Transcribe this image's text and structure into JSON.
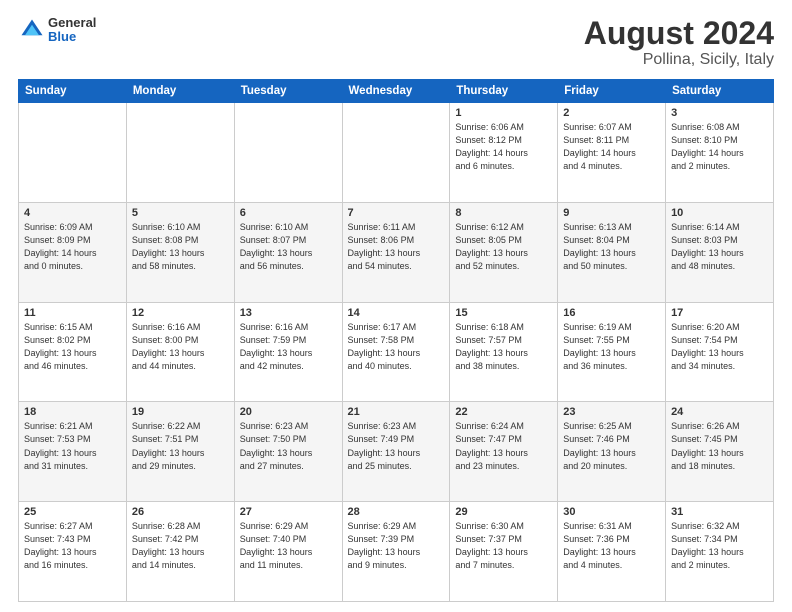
{
  "header": {
    "logo_general": "General",
    "logo_blue": "Blue",
    "month_title": "August 2024",
    "location": "Pollina, Sicily, Italy"
  },
  "weekdays": [
    "Sunday",
    "Monday",
    "Tuesday",
    "Wednesday",
    "Thursday",
    "Friday",
    "Saturday"
  ],
  "rows": [
    [
      {
        "day": "",
        "info": ""
      },
      {
        "day": "",
        "info": ""
      },
      {
        "day": "",
        "info": ""
      },
      {
        "day": "",
        "info": ""
      },
      {
        "day": "1",
        "info": "Sunrise: 6:06 AM\nSunset: 8:12 PM\nDaylight: 14 hours\nand 6 minutes."
      },
      {
        "day": "2",
        "info": "Sunrise: 6:07 AM\nSunset: 8:11 PM\nDaylight: 14 hours\nand 4 minutes."
      },
      {
        "day": "3",
        "info": "Sunrise: 6:08 AM\nSunset: 8:10 PM\nDaylight: 14 hours\nand 2 minutes."
      }
    ],
    [
      {
        "day": "4",
        "info": "Sunrise: 6:09 AM\nSunset: 8:09 PM\nDaylight: 14 hours\nand 0 minutes."
      },
      {
        "day": "5",
        "info": "Sunrise: 6:10 AM\nSunset: 8:08 PM\nDaylight: 13 hours\nand 58 minutes."
      },
      {
        "day": "6",
        "info": "Sunrise: 6:10 AM\nSunset: 8:07 PM\nDaylight: 13 hours\nand 56 minutes."
      },
      {
        "day": "7",
        "info": "Sunrise: 6:11 AM\nSunset: 8:06 PM\nDaylight: 13 hours\nand 54 minutes."
      },
      {
        "day": "8",
        "info": "Sunrise: 6:12 AM\nSunset: 8:05 PM\nDaylight: 13 hours\nand 52 minutes."
      },
      {
        "day": "9",
        "info": "Sunrise: 6:13 AM\nSunset: 8:04 PM\nDaylight: 13 hours\nand 50 minutes."
      },
      {
        "day": "10",
        "info": "Sunrise: 6:14 AM\nSunset: 8:03 PM\nDaylight: 13 hours\nand 48 minutes."
      }
    ],
    [
      {
        "day": "11",
        "info": "Sunrise: 6:15 AM\nSunset: 8:02 PM\nDaylight: 13 hours\nand 46 minutes."
      },
      {
        "day": "12",
        "info": "Sunrise: 6:16 AM\nSunset: 8:00 PM\nDaylight: 13 hours\nand 44 minutes."
      },
      {
        "day": "13",
        "info": "Sunrise: 6:16 AM\nSunset: 7:59 PM\nDaylight: 13 hours\nand 42 minutes."
      },
      {
        "day": "14",
        "info": "Sunrise: 6:17 AM\nSunset: 7:58 PM\nDaylight: 13 hours\nand 40 minutes."
      },
      {
        "day": "15",
        "info": "Sunrise: 6:18 AM\nSunset: 7:57 PM\nDaylight: 13 hours\nand 38 minutes."
      },
      {
        "day": "16",
        "info": "Sunrise: 6:19 AM\nSunset: 7:55 PM\nDaylight: 13 hours\nand 36 minutes."
      },
      {
        "day": "17",
        "info": "Sunrise: 6:20 AM\nSunset: 7:54 PM\nDaylight: 13 hours\nand 34 minutes."
      }
    ],
    [
      {
        "day": "18",
        "info": "Sunrise: 6:21 AM\nSunset: 7:53 PM\nDaylight: 13 hours\nand 31 minutes."
      },
      {
        "day": "19",
        "info": "Sunrise: 6:22 AM\nSunset: 7:51 PM\nDaylight: 13 hours\nand 29 minutes."
      },
      {
        "day": "20",
        "info": "Sunrise: 6:23 AM\nSunset: 7:50 PM\nDaylight: 13 hours\nand 27 minutes."
      },
      {
        "day": "21",
        "info": "Sunrise: 6:23 AM\nSunset: 7:49 PM\nDaylight: 13 hours\nand 25 minutes."
      },
      {
        "day": "22",
        "info": "Sunrise: 6:24 AM\nSunset: 7:47 PM\nDaylight: 13 hours\nand 23 minutes."
      },
      {
        "day": "23",
        "info": "Sunrise: 6:25 AM\nSunset: 7:46 PM\nDaylight: 13 hours\nand 20 minutes."
      },
      {
        "day": "24",
        "info": "Sunrise: 6:26 AM\nSunset: 7:45 PM\nDaylight: 13 hours\nand 18 minutes."
      }
    ],
    [
      {
        "day": "25",
        "info": "Sunrise: 6:27 AM\nSunset: 7:43 PM\nDaylight: 13 hours\nand 16 minutes."
      },
      {
        "day": "26",
        "info": "Sunrise: 6:28 AM\nSunset: 7:42 PM\nDaylight: 13 hours\nand 14 minutes."
      },
      {
        "day": "27",
        "info": "Sunrise: 6:29 AM\nSunset: 7:40 PM\nDaylight: 13 hours\nand 11 minutes."
      },
      {
        "day": "28",
        "info": "Sunrise: 6:29 AM\nSunset: 7:39 PM\nDaylight: 13 hours\nand 9 minutes."
      },
      {
        "day": "29",
        "info": "Sunrise: 6:30 AM\nSunset: 7:37 PM\nDaylight: 13 hours\nand 7 minutes."
      },
      {
        "day": "30",
        "info": "Sunrise: 6:31 AM\nSunset: 7:36 PM\nDaylight: 13 hours\nand 4 minutes."
      },
      {
        "day": "31",
        "info": "Sunrise: 6:32 AM\nSunset: 7:34 PM\nDaylight: 13 hours\nand 2 minutes."
      }
    ]
  ]
}
